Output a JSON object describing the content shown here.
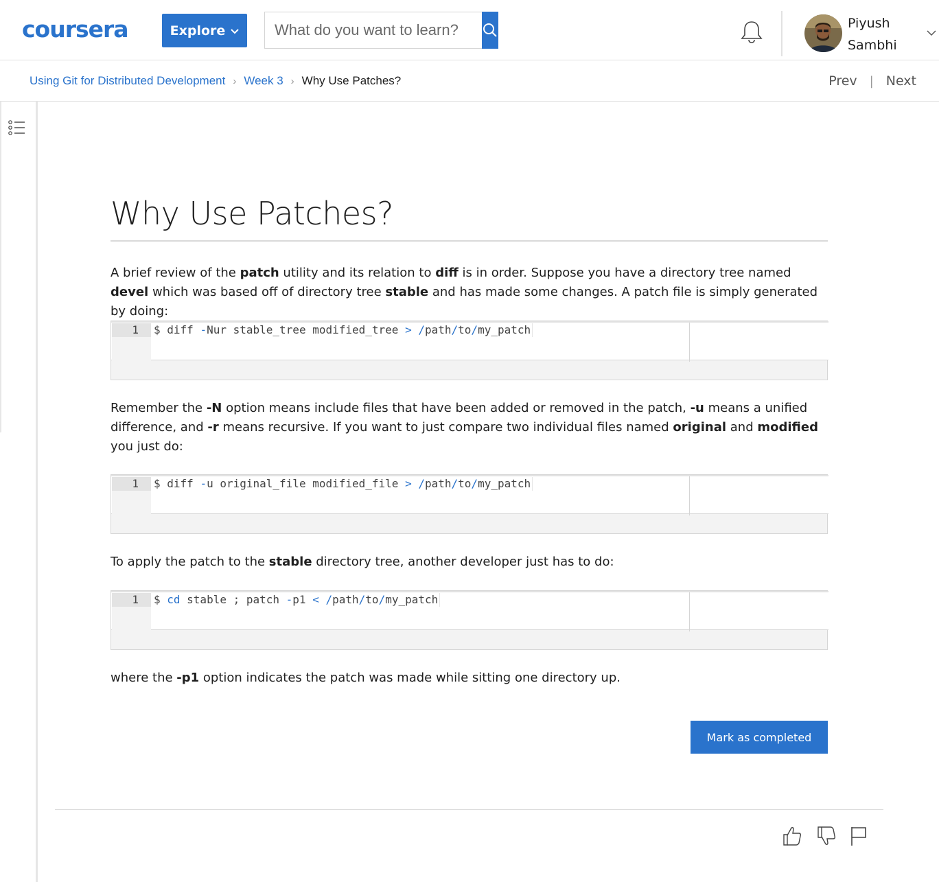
{
  "header": {
    "brand": "coursera",
    "explore_label": "Explore",
    "search_placeholder": "What do you want to learn?",
    "user": {
      "first": "Piyush",
      "last": "Sambhi"
    }
  },
  "breadcrumb": {
    "course": "Using Git for Distributed Development",
    "week": "Week 3",
    "current": "Why Use Patches?"
  },
  "nav": {
    "prev": "Prev",
    "next": "Next",
    "separator": "|"
  },
  "page": {
    "title": "Why Use Patches?",
    "para1": [
      {
        "t": "A brief review of the "
      },
      {
        "t": "patch",
        "b": true
      },
      {
        "t": " utility and its relation to "
      },
      {
        "t": "diff",
        "b": true
      },
      {
        "t": " is in order. Suppose you have a directory tree named "
      },
      {
        "t": "devel",
        "b": true
      },
      {
        "t": " which was based off of directory tree "
      },
      {
        "t": "stable",
        "b": true
      },
      {
        "t": " and has made some changes. A patch file is simply generated by doing:"
      }
    ],
    "code1": {
      "line_no": "1",
      "parts": [
        {
          "t": "$ diff "
        },
        {
          "t": "-",
          "c": "op"
        },
        {
          "t": "Nur stable_tree modified_tree "
        },
        {
          "t": ">",
          "c": "op"
        },
        {
          "t": " "
        },
        {
          "t": "/",
          "c": "op"
        },
        {
          "t": "path"
        },
        {
          "t": "/",
          "c": "op"
        },
        {
          "t": "to"
        },
        {
          "t": "/",
          "c": "op"
        },
        {
          "t": "my_patch"
        }
      ]
    },
    "para2": [
      {
        "t": "Remember the "
      },
      {
        "t": "-N",
        "b": true
      },
      {
        "t": " option means include files that have been added or removed in the patch, "
      },
      {
        "t": "-u",
        "b": true
      },
      {
        "t": " means a unified difference, and "
      },
      {
        "t": "-r",
        "b": true
      },
      {
        "t": " means recursive. If you want to just compare two individual files named "
      },
      {
        "t": "original",
        "b": true
      },
      {
        "t": " and "
      },
      {
        "t": "modified",
        "b": true
      },
      {
        "t": " you just do:"
      }
    ],
    "code2": {
      "line_no": "1",
      "parts": [
        {
          "t": "$ diff "
        },
        {
          "t": "-",
          "c": "op"
        },
        {
          "t": "u original_file modified_file "
        },
        {
          "t": ">",
          "c": "op"
        },
        {
          "t": " "
        },
        {
          "t": "/",
          "c": "op"
        },
        {
          "t": "path"
        },
        {
          "t": "/",
          "c": "op"
        },
        {
          "t": "to"
        },
        {
          "t": "/",
          "c": "op"
        },
        {
          "t": "my_patch"
        }
      ]
    },
    "para3": [
      {
        "t": "To apply the patch to the "
      },
      {
        "t": "stable",
        "b": true
      },
      {
        "t": " directory tree, another developer just has to do:"
      }
    ],
    "code3": {
      "line_no": "1",
      "parts": [
        {
          "t": "$ "
        },
        {
          "t": "cd",
          "c": "kw"
        },
        {
          "t": " stable ; patch "
        },
        {
          "t": "-",
          "c": "op"
        },
        {
          "t": "p1 "
        },
        {
          "t": "<",
          "c": "op"
        },
        {
          "t": " "
        },
        {
          "t": "/",
          "c": "op"
        },
        {
          "t": "path"
        },
        {
          "t": "/",
          "c": "op"
        },
        {
          "t": "to"
        },
        {
          "t": "/",
          "c": "op"
        },
        {
          "t": "my_patch"
        }
      ]
    },
    "para4": [
      {
        "t": "where the "
      },
      {
        "t": "-p1",
        "b": true
      },
      {
        "t": " option indicates the patch was made while sitting one directory up."
      }
    ],
    "mark_completed": "Mark as completed"
  },
  "colors": {
    "accent": "#2a73cc",
    "text": "#1f1f1f",
    "muted": "#555555",
    "border": "#d5d5d5"
  },
  "icons": [
    "bell-icon",
    "search-icon",
    "chevron-down-icon",
    "table-of-contents-icon",
    "thumbs-up-icon",
    "thumbs-down-icon",
    "flag-icon"
  ]
}
